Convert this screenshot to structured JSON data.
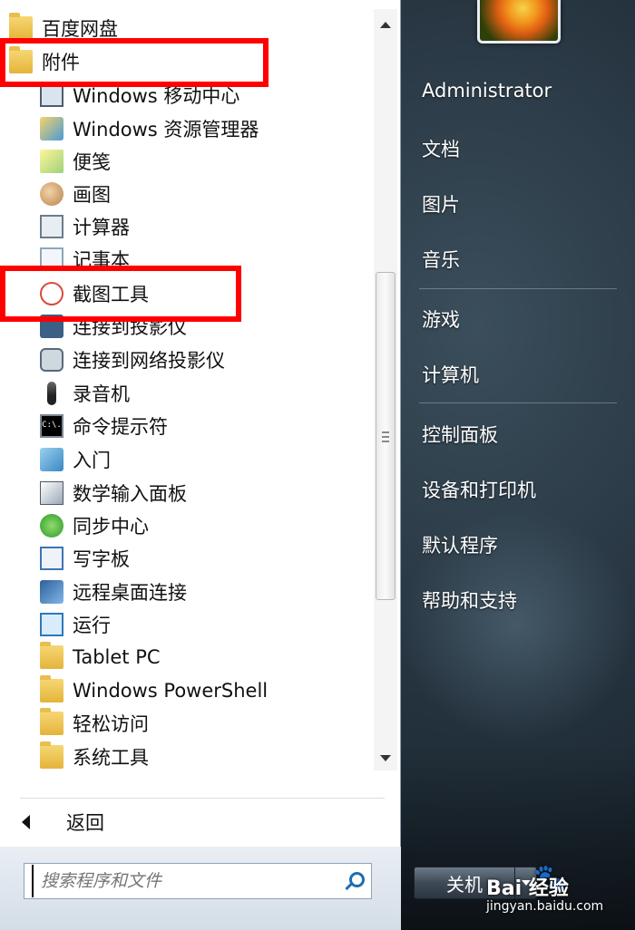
{
  "background": {
    "accent": "#1e6db3",
    "highlight_color": "#ff0000"
  },
  "programs": {
    "items": [
      {
        "label": "百度网盘",
        "icon": "folder-icon"
      },
      {
        "label": "附件",
        "icon": "folder-icon"
      },
      {
        "label": "Windows 移动中心",
        "icon": "mobility-center-icon"
      },
      {
        "label": "Windows 资源管理器",
        "icon": "explorer-icon"
      },
      {
        "label": "便笺",
        "icon": "sticky-notes-icon"
      },
      {
        "label": "画图",
        "icon": "paint-icon"
      },
      {
        "label": "计算器",
        "icon": "calculator-icon"
      },
      {
        "label": "记事本",
        "icon": "notepad-icon"
      },
      {
        "label": "截图工具",
        "icon": "snipping-tool-icon"
      },
      {
        "label": "连接到投影仪",
        "icon": "projector-icon"
      },
      {
        "label": "连接到网络投影仪",
        "icon": "network-projector-icon"
      },
      {
        "label": "录音机",
        "icon": "microphone-icon"
      },
      {
        "label": "命令提示符",
        "icon": "command-prompt-icon"
      },
      {
        "label": "入门",
        "icon": "getting-started-icon"
      },
      {
        "label": "数学输入面板",
        "icon": "math-input-icon"
      },
      {
        "label": "同步中心",
        "icon": "sync-center-icon"
      },
      {
        "label": "写字板",
        "icon": "wordpad-icon"
      },
      {
        "label": "远程桌面连接",
        "icon": "remote-desktop-icon"
      },
      {
        "label": "运行",
        "icon": "run-icon"
      },
      {
        "label": "Tablet PC",
        "icon": "folder-icon"
      },
      {
        "label": "Windows PowerShell",
        "icon": "folder-icon"
      },
      {
        "label": "轻松访问",
        "icon": "folder-icon"
      },
      {
        "label": "系统工具",
        "icon": "folder-icon"
      }
    ],
    "cmd_icon_text": "C:\\."
  },
  "back_label": "返回",
  "search": {
    "placeholder": "搜索程序和文件"
  },
  "right_pane": {
    "items": [
      "Administrator",
      "文档",
      "图片",
      "音乐",
      "游戏",
      "计算机",
      "控制面板",
      "设备和打印机",
      "默认程序",
      "帮助和支持"
    ]
  },
  "shutdown_label": "关机",
  "watermark": {
    "logo": "Bai 经验",
    "paw": "🐾",
    "url": "jingyan.baidu.com"
  }
}
